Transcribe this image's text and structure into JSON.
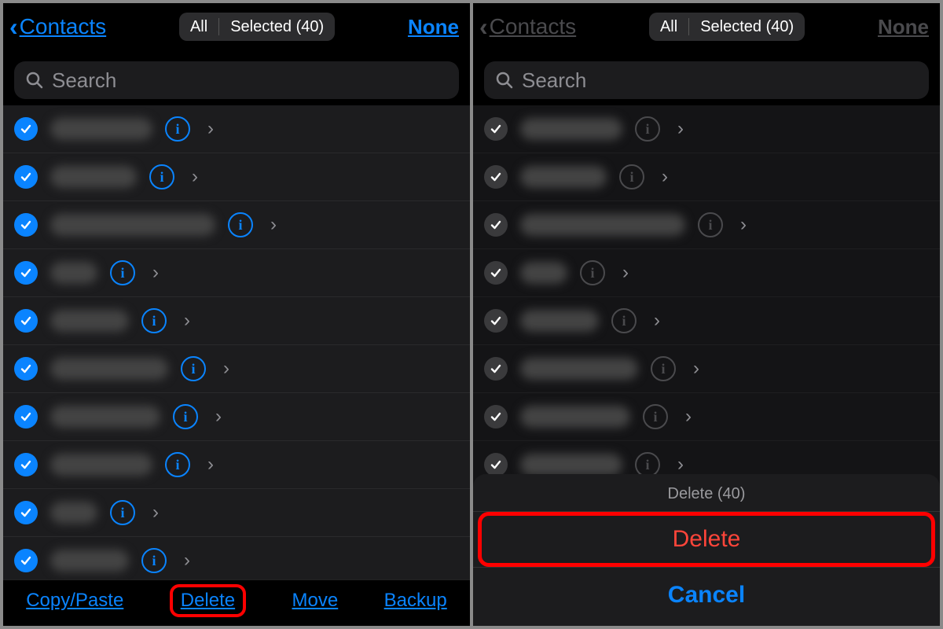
{
  "left": {
    "nav": {
      "back_title": "Contacts",
      "none": "None"
    },
    "segmented": {
      "all": "All",
      "selected": "Selected (40)"
    },
    "search": {
      "placeholder": "Search"
    },
    "toolbar": {
      "copy": "Copy/Paste",
      "delete": "Delete",
      "move": "Move",
      "backup": "Backup"
    }
  },
  "right": {
    "nav": {
      "back_title": "Contacts",
      "none": "None"
    },
    "segmented": {
      "all": "All",
      "selected": "Selected (40)"
    },
    "search": {
      "placeholder": "Search"
    },
    "sheet": {
      "title": "Delete (40)",
      "delete": "Delete",
      "cancel": "Cancel"
    }
  },
  "row_count": 10
}
